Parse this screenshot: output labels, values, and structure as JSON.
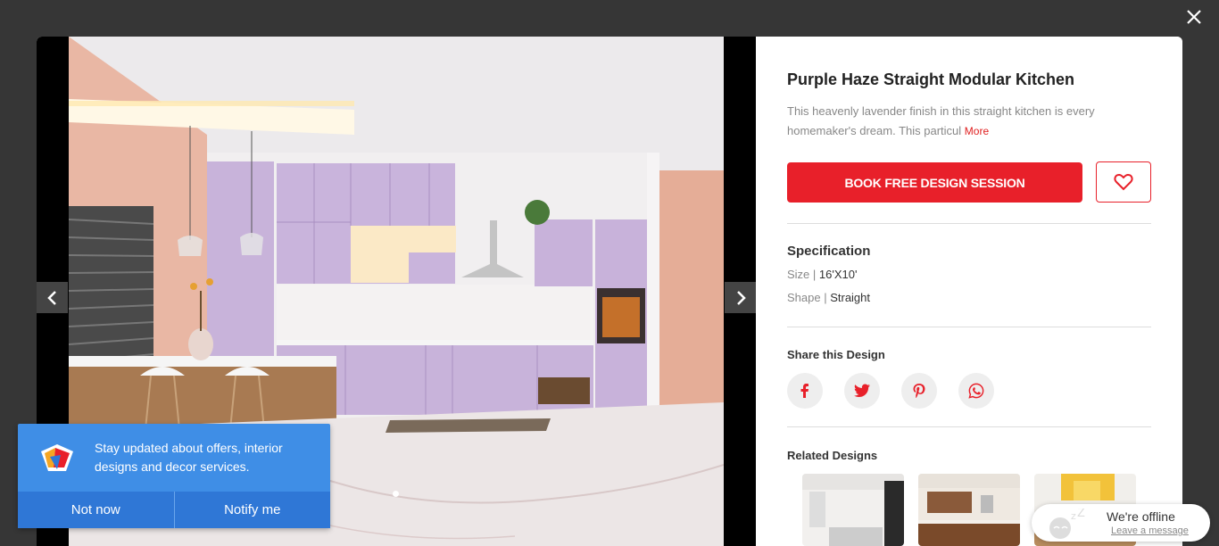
{
  "icons": {
    "close": "close-icon",
    "prev": "chevron-left-icon",
    "next": "chevron-right-icon",
    "favorite": "heart-icon",
    "facebook": "facebook-icon",
    "twitter": "twitter-icon",
    "pinterest": "pinterest-icon",
    "whatsapp": "whatsapp-icon"
  },
  "colors": {
    "accent": "#e8202a",
    "notify_bg": "#3f8ee6",
    "overlay": "#363636"
  },
  "design": {
    "title": "Purple Haze Straight Modular Kitchen",
    "description": "This heavenly lavender finish in this straight kitchen is every homemaker's dream. This particul",
    "more_label": "More",
    "book_label": "BOOK FREE DESIGN SESSION"
  },
  "spec": {
    "title": "Specification",
    "size_key": "Size",
    "size_value": "16'X10'",
    "shape_key": "Shape",
    "shape_value": "Straight",
    "separator": " | "
  },
  "share": {
    "title": "Share this Design"
  },
  "related": {
    "title": "Related Designs"
  },
  "notification": {
    "text": "Stay updated about offers, interior designs and decor services.",
    "not_now": "Not now",
    "notify_me": "Notify me"
  },
  "chat": {
    "status": "We're offline",
    "leave_message": "Leave a message"
  }
}
